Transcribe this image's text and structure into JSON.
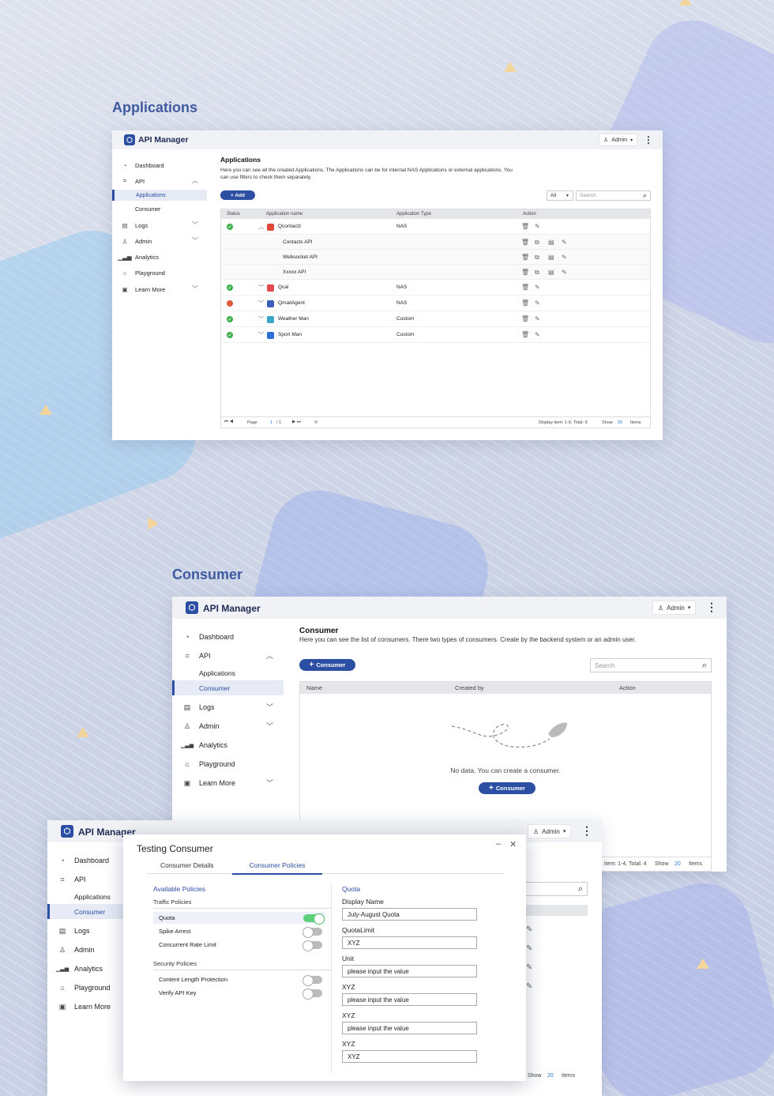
{
  "sections": {
    "applications": "Applications",
    "consumer": "Consumer"
  },
  "app": {
    "name": "API Manager",
    "user": "Admin",
    "user_caret": "▾",
    "more": "⋮"
  },
  "nav": {
    "dashboard": "Dashboard",
    "api": "API",
    "applications": "Applications",
    "consumer": "Consumer",
    "logs": "Logs",
    "admin": "Admin",
    "analytics": "Analytics",
    "playground": "Playground",
    "learn_more": "Learn More"
  },
  "apps_page": {
    "title": "Applications",
    "desc": "Here you can see all the created Applications. The Applications can be for internal NAS Applications or external applications. You can use filters to check them separately.",
    "add_label": "+ Add",
    "filter": "All",
    "search_placeholder": "Search",
    "columns": [
      "Status",
      "Application name",
      "Application Type",
      "Action"
    ],
    "rows": [
      {
        "status": "ok",
        "name": "Qcontactz",
        "type": "NAS",
        "expanded": true,
        "icon_color": "#e0483a"
      },
      {
        "status": "child",
        "name": "Contacts API",
        "type": ""
      },
      {
        "status": "child",
        "name": "Websocket API",
        "type": ""
      },
      {
        "status": "child",
        "name": "Xxxxx API",
        "type": ""
      },
      {
        "status": "ok",
        "name": "Qcal",
        "type": "NAS",
        "icon_color": "#e04a4a"
      },
      {
        "status": "stop",
        "name": "QmailAgent",
        "type": "NAS",
        "icon_color": "#3a5fb8"
      },
      {
        "status": "ok",
        "name": "Weather Man",
        "type": "Custom",
        "icon_color": "#3aa6c8"
      },
      {
        "status": "ok",
        "name": "Sport Man",
        "type": "Custom",
        "icon_color": "#2d6fd6"
      }
    ],
    "pager": {
      "page_label": "Page",
      "page": "1",
      "of": "/ 1",
      "display": "Display item: 1-9, Total: 9",
      "show": "Show",
      "count": "20",
      "items": "Items"
    }
  },
  "consumer_page": {
    "title": "Consumer",
    "desc": "Here you can see the list of consumers. There two types of consumers. Create by the backend system or an admin user.",
    "add_label": "Consumer",
    "search_placeholder": "Search",
    "columns": [
      "Name",
      "Created by",
      "Action"
    ],
    "empty": "No data. You can create a consumer.",
    "empty_btn": "Consumer",
    "pager": {
      "display": "item: 1-4, Total: 4",
      "show": "Show",
      "count": "20",
      "items": "Items"
    }
  },
  "modal": {
    "title": "Testing Consumer",
    "tabs": [
      "Consumer Details",
      "Consumer Policies"
    ],
    "available": "Available Policies",
    "traffic": "Traffic Policies",
    "traffic_items": [
      {
        "label": "Quota",
        "on": true
      },
      {
        "label": "Spike Arrest",
        "on": false
      },
      {
        "label": "Concurrent Rate Limit",
        "on": false
      }
    ],
    "security": "Security Policies",
    "security_items": [
      {
        "label": "Content Length Protection",
        "on": false
      },
      {
        "label": "Verify API Key",
        "on": false
      }
    ],
    "quota_title": "Quota",
    "fields": [
      {
        "label": "Display Name",
        "value": "July-August Quota"
      },
      {
        "label": "QuotaLimit",
        "value": "XYZ"
      },
      {
        "label": "Unit",
        "value": "please input the value"
      },
      {
        "label": "XYZ",
        "value": "please input the value"
      },
      {
        "label": "XYZ",
        "value": "please input the value"
      },
      {
        "label": "XYZ",
        "value": "XYZ"
      }
    ],
    "minimize": "–",
    "close": "✕"
  },
  "third": {
    "show": "Show",
    "count": "20",
    "items": "Items"
  }
}
